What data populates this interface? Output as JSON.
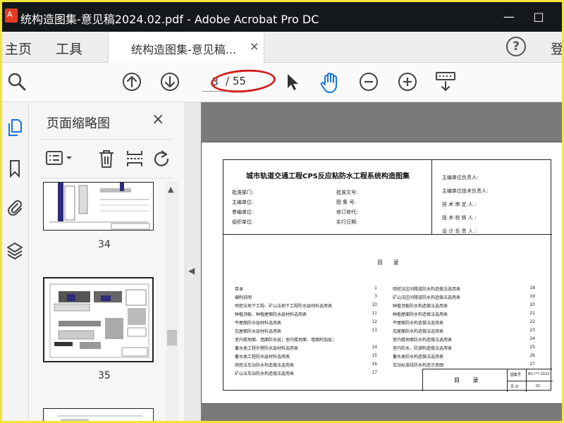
{
  "window": {
    "title": "统构造图集-意见稿2024.02.pdf - Adobe Acrobat Pro DC",
    "minimize_glyph": "—",
    "maximize_glyph": "□"
  },
  "menubar": {
    "home": "主页",
    "tools": "工具",
    "doc_tab_label": "统构造图集-意见稿...",
    "doc_tab_close": "×",
    "help": "?",
    "login": "登"
  },
  "toolbar": {
    "current_page": "3",
    "page_total": "/ 55"
  },
  "thumbnail_panel": {
    "title": "页面缩略图",
    "close": "×",
    "pages": [
      {
        "number": "34"
      },
      {
        "number": "35"
      }
    ]
  },
  "document": {
    "title": "城市轨道交通工程CPS反应粘防水工程系统构造图集",
    "meta_left": [
      "批准部门:",
      "主编单位:",
      "参编单位:",
      "组织单位:"
    ],
    "meta_mid": [
      "批准文号:",
      "图 集 号:",
      "修订修代:",
      "实行日期:"
    ],
    "meta_right": [
      "主编单位负责人:",
      "主编单位技术负责人:",
      "技 术 审 定 人 :",
      "技 术 校 核 人 :",
      "设 计 负 责 人 :"
    ],
    "toc_heading": "目 录",
    "toc_left": [
      {
        "text": "目录",
        "page": "1"
      },
      {
        "text": "编制说明",
        "page": "3"
      },
      {
        "text": "明挖法地下工程、矿山法地下工程防水层材料选用表",
        "page": "10"
      },
      {
        "text": "种植顶板、种植屋面防水层材料选用表",
        "page": "11"
      },
      {
        "text": "平屋面防水层材料选用表",
        "page": "12"
      },
      {
        "text": "瓦屋面防水层材料选用表",
        "page": "13"
      },
      {
        "text": "室内楼地面、墙面防水层；室内楼地面、墙面附加层；",
        "page": ""
      },
      {
        "text": "蓄水类工程外壁防水层材料选用表",
        "page": "14"
      },
      {
        "text": "蓄水类工程防水层材料选用表",
        "page": "15"
      },
      {
        "text": "明挖法车站防水构造做法选用表",
        "page": "16"
      },
      {
        "text": "矿山法车站防水构造做法选用表",
        "page": "17"
      }
    ],
    "toc_right": [
      {
        "text": "明挖法区间隧道防水构造做法选用表",
        "page": "18"
      },
      {
        "text": "矿山法区间隧道防水构造做法选用表",
        "page": "19"
      },
      {
        "text": "种植顶板防水构造做法选用表",
        "page": "20"
      },
      {
        "text": "种植屋面防水构造做法选用表",
        "page": "21"
      },
      {
        "text": "平屋面防水构造做法选用表",
        "page": "22"
      },
      {
        "text": "瓦屋面防水构造做法选用表",
        "page": "23"
      },
      {
        "text": "室内楼地面防水构造做法选用表",
        "page": "24"
      },
      {
        "text": "室内防水、防潮构造做法选用表",
        "page": "25"
      },
      {
        "text": "蓄水类防水构造做法选用表",
        "page": "26"
      },
      {
        "text": "车站标准段防水构造示意图",
        "page": "27"
      }
    ],
    "stamp": {
      "title": "目 录",
      "atlas_label": "图集号",
      "atlas_value": "BS-***-2023",
      "page_label": "页 次",
      "page_value": "01"
    }
  },
  "colors": {
    "titlebar": "#14181a",
    "highlight": "#d42020",
    "frame": "#f2e43a",
    "pdf_icon": "#e43b25"
  }
}
